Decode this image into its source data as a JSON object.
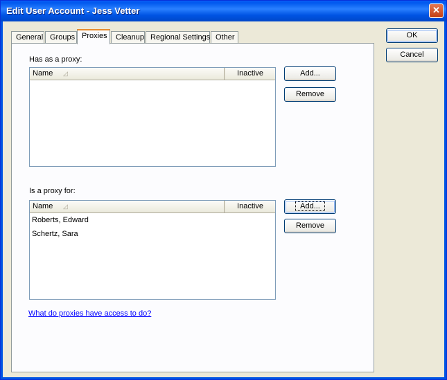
{
  "window": {
    "title": "Edit User Account - Jess Vetter",
    "close_glyph": "✕"
  },
  "tabs": [
    {
      "label": "General"
    },
    {
      "label": "Groups"
    },
    {
      "label": "Proxies"
    },
    {
      "label": "Cleanup"
    },
    {
      "label": "Regional Settings"
    },
    {
      "label": "Other"
    }
  ],
  "active_tab": "Proxies",
  "dialog_buttons": {
    "ok": "OK",
    "cancel": "Cancel"
  },
  "has_proxy": {
    "label": "Has as a proxy:",
    "columns": {
      "name": "Name",
      "inactive": "Inactive"
    },
    "rows": [],
    "add_label": "Add...",
    "remove_label": "Remove"
  },
  "is_proxy_for": {
    "label": "Is a proxy for:",
    "columns": {
      "name": "Name",
      "inactive": "Inactive"
    },
    "rows": [
      {
        "name": "Roberts, Edward",
        "inactive": ""
      },
      {
        "name": "Schertz, Sara",
        "inactive": ""
      }
    ],
    "add_label": "Add...",
    "remove_label": "Remove"
  },
  "help_link": "What do proxies have access to do?"
}
